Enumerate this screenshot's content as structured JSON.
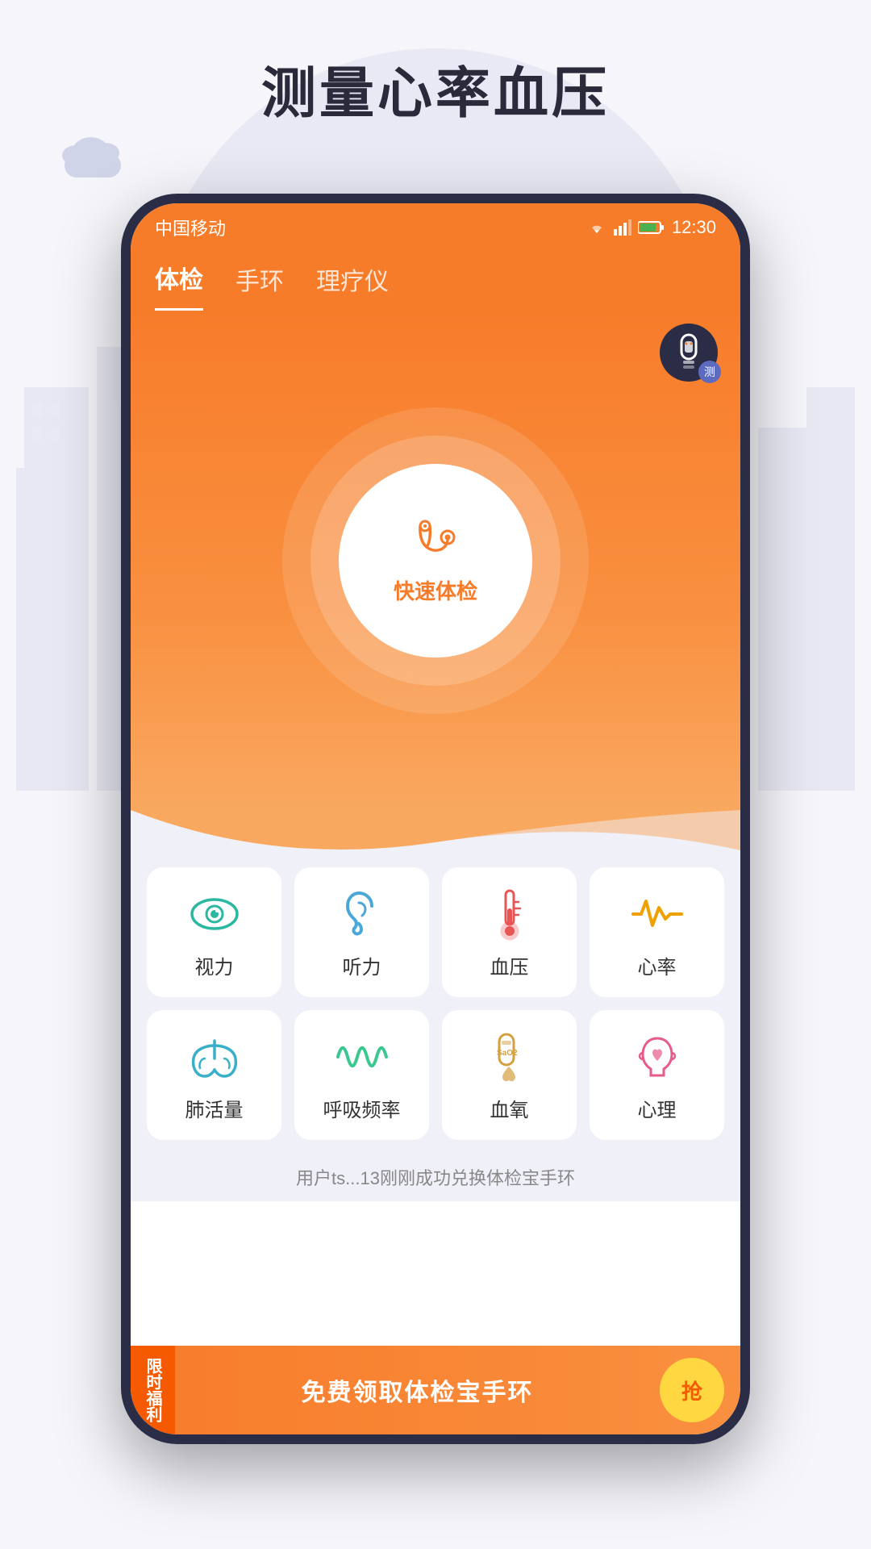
{
  "page": {
    "title": "测量心率血压",
    "background_color": "#f0f0f8"
  },
  "status_bar": {
    "carrier": "中国移动",
    "time": "12:30",
    "signal_icon": "▼",
    "battery_color": "#4caf50"
  },
  "nav": {
    "tabs": [
      {
        "label": "体检",
        "active": true
      },
      {
        "label": "手环",
        "active": false
      },
      {
        "label": "理疗仪",
        "active": false
      }
    ]
  },
  "main_button": {
    "icon": "🩺",
    "label": "快速体检"
  },
  "wristband": {
    "badge": "测"
  },
  "grid_row1": [
    {
      "icon": "👁",
      "label": "视力",
      "icon_name": "eye-icon"
    },
    {
      "icon": "👂",
      "label": "听力",
      "icon_name": "ear-icon"
    },
    {
      "icon": "🌡",
      "label": "血压",
      "icon_name": "thermometer-icon"
    },
    {
      "icon": "📈",
      "label": "心率",
      "icon_name": "heartrate-icon"
    }
  ],
  "grid_row2": [
    {
      "icon": "🫁",
      "label": "肺活量",
      "icon_name": "lungs-icon"
    },
    {
      "icon": "〰",
      "label": "呼吸频率",
      "icon_name": "wave-icon"
    },
    {
      "icon": "💉",
      "label": "血氧",
      "icon_name": "blood-icon"
    },
    {
      "icon": "🧠",
      "label": "心理",
      "icon_name": "mental-icon"
    }
  ],
  "notification": {
    "text": "用户ts...13刚刚成功兑换体检宝手环"
  },
  "banner": {
    "tag": "限时福利",
    "text": "免费领取体检宝手环",
    "button": "抢"
  }
}
